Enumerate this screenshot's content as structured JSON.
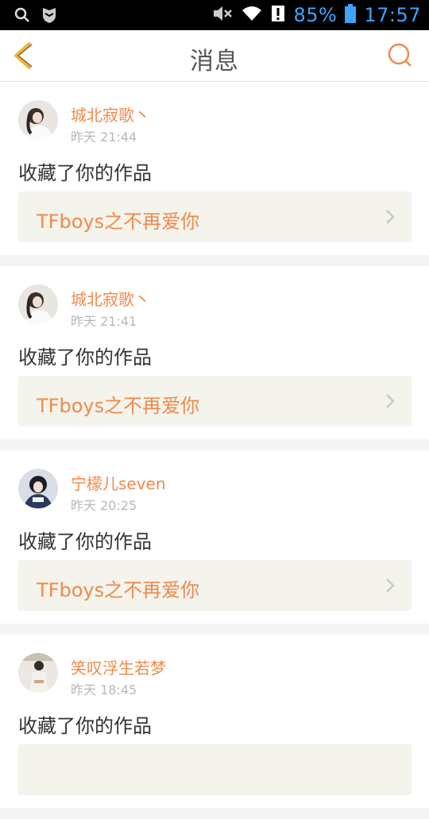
{
  "statusbar": {
    "battery_pct": "85%",
    "time": "17:57",
    "icons": [
      "search-icon",
      "shield-icon",
      "mute-icon",
      "wifi-icon",
      "alert-icon",
      "battery-icon"
    ]
  },
  "header": {
    "title": "消息",
    "back_icon": "chevron-left-icon",
    "search_icon": "search-icon",
    "accent_color": "#f08a4b"
  },
  "messages": [
    {
      "username": "城北寂歌丶",
      "time": "昨天 21:44",
      "action": "收藏了你的作品",
      "work_title": "TFboys之不再爱你"
    },
    {
      "username": "城北寂歌丶",
      "time": "昨天 21:41",
      "action": "收藏了你的作品",
      "work_title": "TFboys之不再爱你"
    },
    {
      "username": "宁檬儿seven",
      "time": "昨天 20:25",
      "action": "收藏了你的作品",
      "work_title": "TFboys之不再爱你"
    },
    {
      "username": "笑叹浮生若梦",
      "time": "昨天 18:45",
      "action": "收藏了你的作品",
      "work_title": ""
    }
  ]
}
